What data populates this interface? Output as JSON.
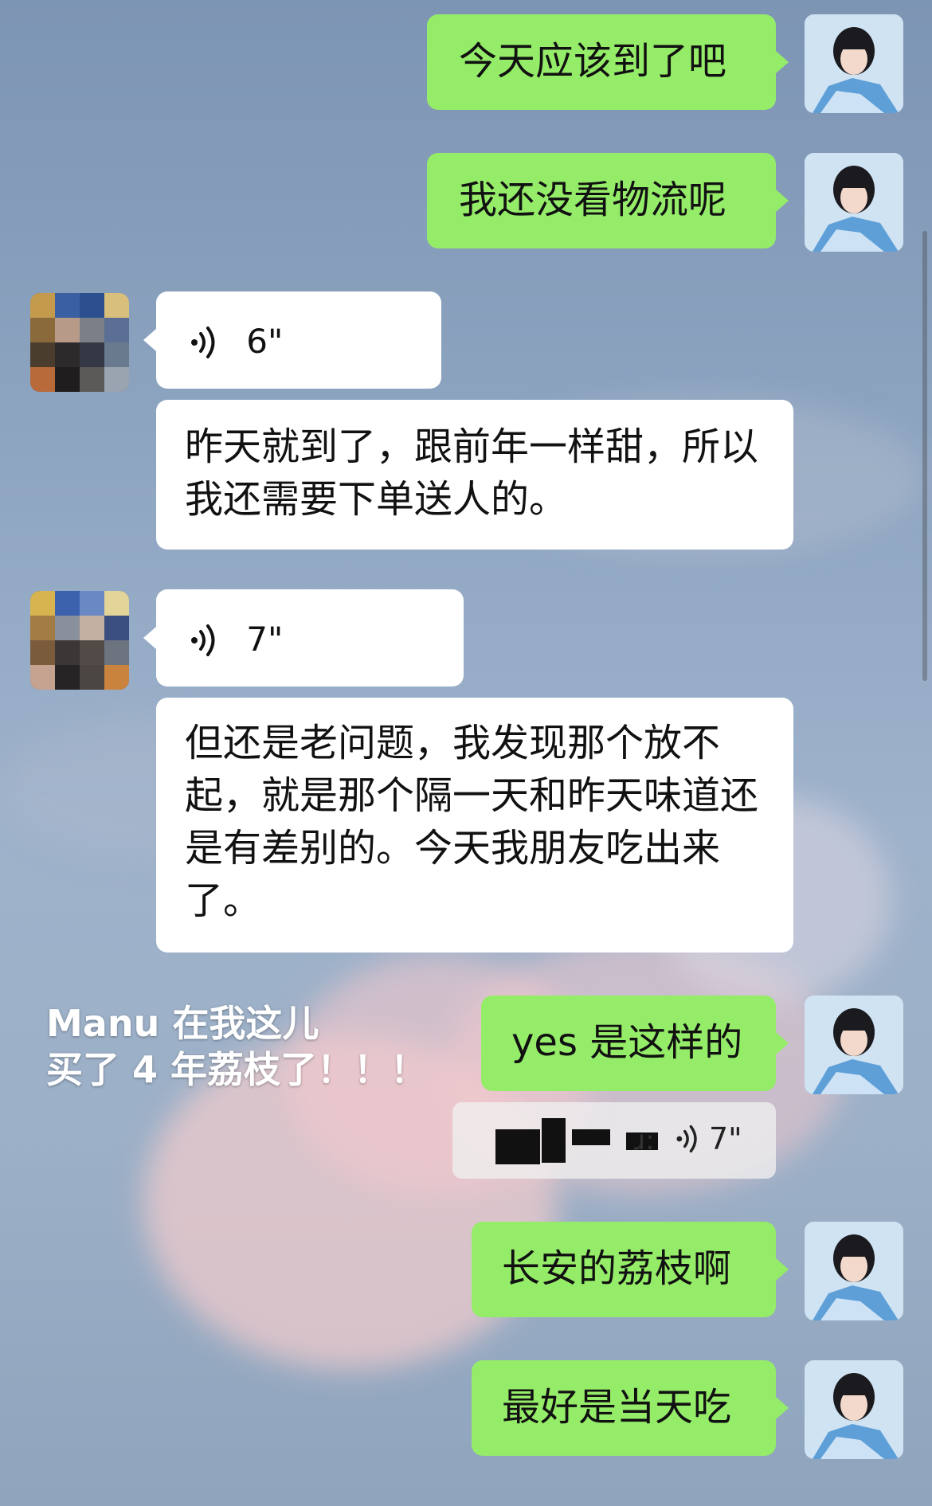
{
  "chat": {
    "messages": [
      {
        "side": "self",
        "type": "text",
        "text": "今天应该到了吧",
        "avatar": "self-avatar"
      },
      {
        "side": "self",
        "type": "text",
        "text": "我还没看物流呢",
        "avatar": "self-avatar"
      },
      {
        "side": "other",
        "type": "voice",
        "duration": "6\""
      },
      {
        "side": "other",
        "type": "text",
        "text": "昨天就到了，跟前年一样甜，所以我还需要下单送人的。"
      },
      {
        "side": "other",
        "type": "voice",
        "duration": "7\""
      },
      {
        "side": "other",
        "type": "text",
        "text": "但还是老问题，我发现那个放不起，就是那个隔一天和昨天味道还是有差别的。今天我朋友吃出来了。"
      },
      {
        "side": "self",
        "type": "text",
        "text": "yes 是这样的"
      },
      {
        "side": "self",
        "type": "quote",
        "quote_suffix": "ɹ:",
        "quote_voice_duration": "7\""
      },
      {
        "side": "self",
        "type": "text",
        "text": "长安的荔枝啊"
      },
      {
        "side": "self",
        "type": "text",
        "text": "最好是当天吃"
      }
    ]
  },
  "overlay": {
    "line1": "Manu 在我这儿",
    "line2": "买了 4 年荔枝了！！！"
  },
  "colors": {
    "self_bubble": "#95ec69",
    "other_bubble": "#ffffff",
    "background_sky": "#8ea5c1"
  },
  "icons": {
    "voice": "voice-wave-icon"
  }
}
